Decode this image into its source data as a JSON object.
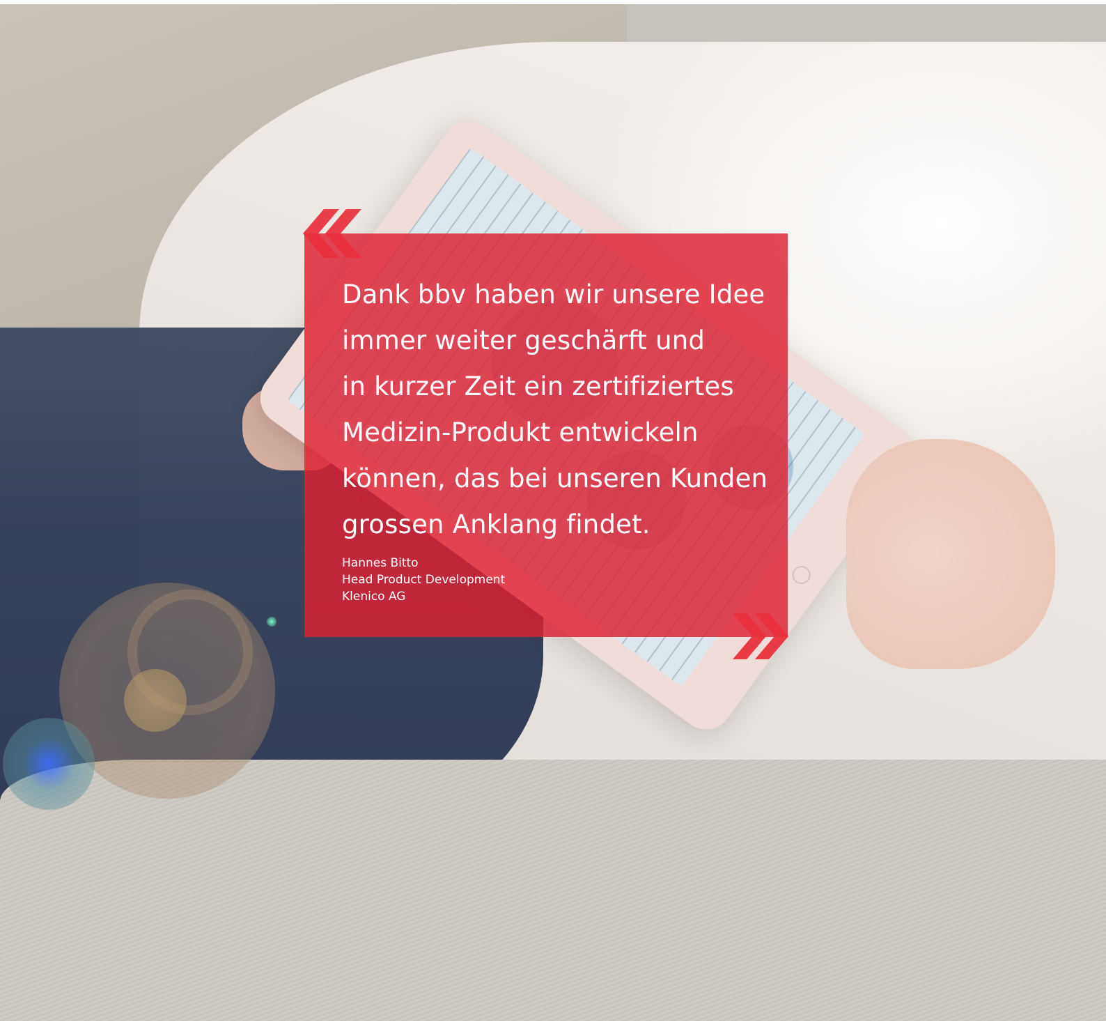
{
  "testimonial": {
    "quote_lines": [
      "Dank bbv haben wir unsere Idee",
      "immer weiter geschärft und",
      "in kurzer Zeit ein zertifiziertes",
      "Medizin-Produkt entwickeln",
      "können, das bei unseren Kunden",
      "grossen Anklang findet."
    ],
    "author_name": "Hannes Bitto",
    "author_role": "Head Product Development",
    "author_company": "Klenico AG"
  },
  "colors": {
    "accent": "#de2131",
    "quote_mark": "#e8303c",
    "text": "#ffffff"
  },
  "icons": {
    "open_quote": "left-double-angle-quote-icon",
    "close_quote": "right-double-angle-quote-icon"
  }
}
